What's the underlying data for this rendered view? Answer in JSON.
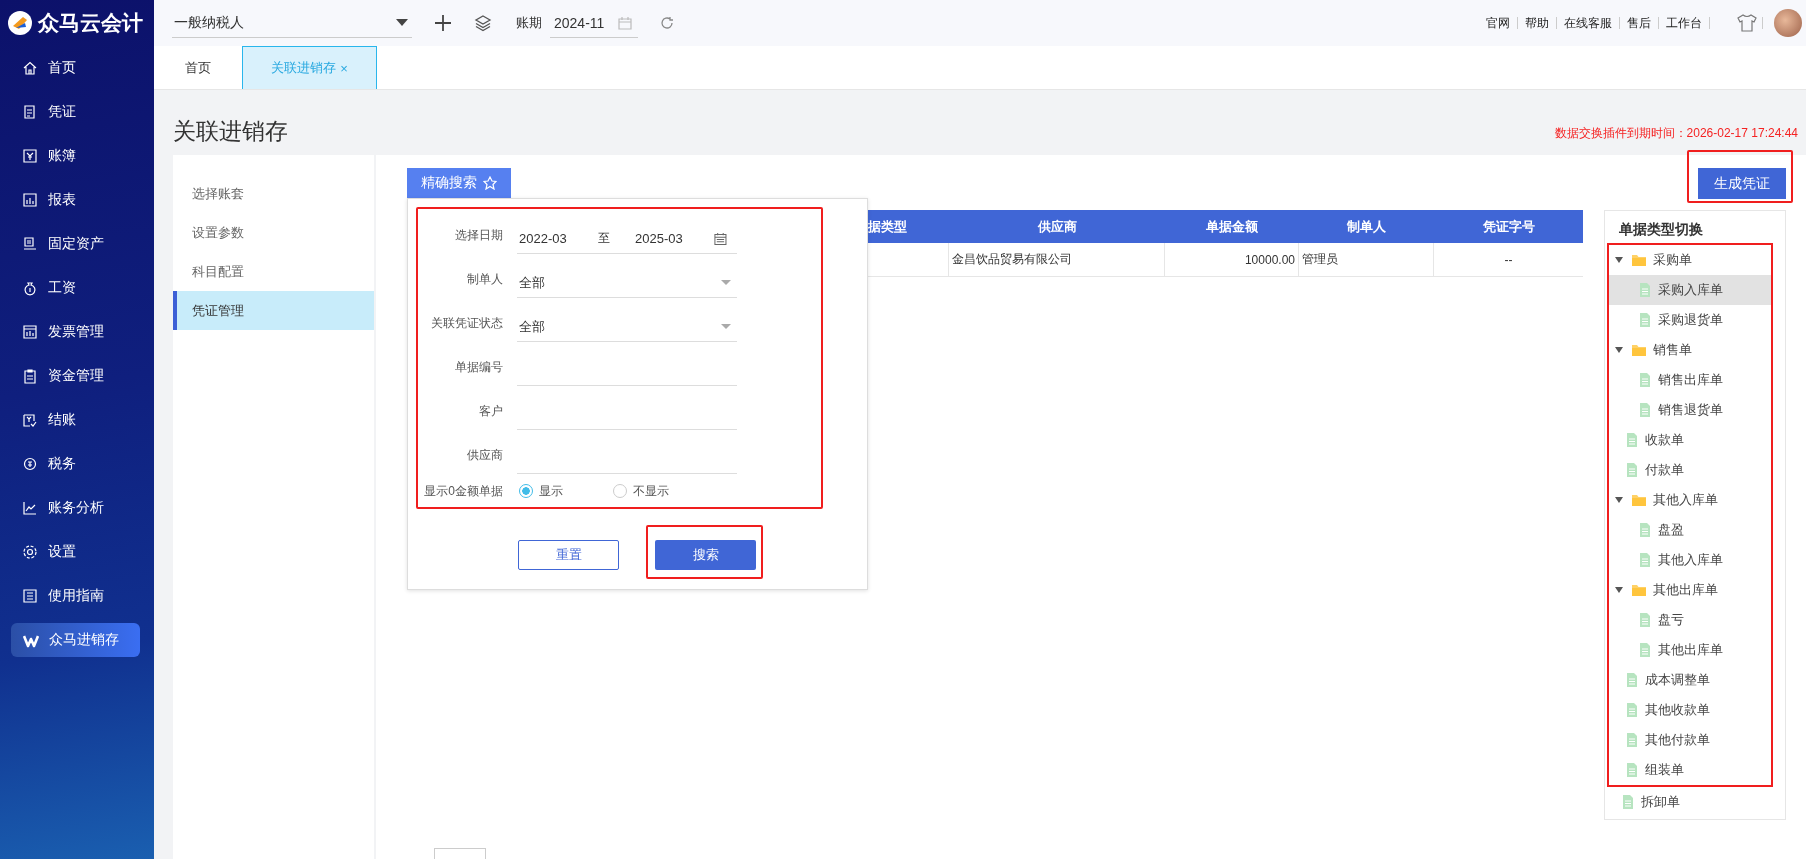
{
  "app": {
    "name": "众马云会计"
  },
  "topbar": {
    "taxpayer_select": "一般纳税人",
    "period_label": "账期",
    "period": "2024-11",
    "links": [
      "官网",
      "帮助",
      "在线客服",
      "售后",
      "工作台"
    ]
  },
  "sidebar": {
    "items": [
      {
        "label": "首页",
        "selected": false
      },
      {
        "label": "凭证",
        "selected": false
      },
      {
        "label": "账簿",
        "selected": false
      },
      {
        "label": "报表",
        "selected": false
      },
      {
        "label": "固定资产",
        "selected": false
      },
      {
        "label": "工资",
        "selected": false
      },
      {
        "label": "发票管理",
        "selected": false
      },
      {
        "label": "资金管理",
        "selected": false
      },
      {
        "label": "结账",
        "selected": false
      },
      {
        "label": "税务",
        "selected": false
      },
      {
        "label": "账务分析",
        "selected": false
      },
      {
        "label": "设置",
        "selected": false
      },
      {
        "label": "使用指南",
        "selected": false
      },
      {
        "label": "众马进销存",
        "selected": true
      }
    ]
  },
  "tabs": [
    {
      "label": "首页",
      "selected": false
    },
    {
      "label": "关联进销存",
      "selected": true,
      "close": "×"
    }
  ],
  "page": {
    "title": "关联进销存",
    "notice": "数据交换插件到期时间：2026-02-17 17:24:44"
  },
  "settings_nav": {
    "items": [
      {
        "label": "选择账套",
        "selected": false
      },
      {
        "label": "设置参数",
        "selected": false
      },
      {
        "label": "科目配置",
        "selected": false
      },
      {
        "label": "凭证管理",
        "selected": true
      }
    ]
  },
  "search_panel": {
    "tab_label": "精确搜索",
    "highlighted": true,
    "fields": [
      {
        "kind": "date_range",
        "label": "选择日期",
        "from": "2022-03",
        "separator": "至",
        "to": "2025-03"
      },
      {
        "kind": "select",
        "label": "制单人",
        "value": "全部"
      },
      {
        "kind": "select",
        "label": "关联凭证状态",
        "value": "全部"
      },
      {
        "kind": "text",
        "label": "单据编号"
      },
      {
        "kind": "text",
        "label": "客户"
      },
      {
        "kind": "text",
        "label": "供应商"
      },
      {
        "kind": "radio",
        "label": "显示0金额单据",
        "options": [
          {
            "label": "显示",
            "selected": true
          },
          {
            "label": "不显示",
            "selected": false
          }
        ]
      }
    ],
    "buttons": [
      {
        "kind": "secondary",
        "label": "重置",
        "highlighted": false
      },
      {
        "kind": "primary",
        "label": "搜索",
        "highlighted": true
      }
    ]
  },
  "generate_button": {
    "label": "生成凭证",
    "highlighted": true
  },
  "table": {
    "columns": [
      "据类型",
      "供应商",
      "单据金额",
      "制单人",
      "凭证字号"
    ],
    "rows": [
      {
        "supplier": "金昌饮品贸易有限公司",
        "amount": "10000.00",
        "creator": "管理员",
        "voucher_no": "--"
      }
    ]
  },
  "doc_type_tree": {
    "title": "单据类型切换",
    "items": [
      {
        "kind": "folder",
        "label": "采购单",
        "expanded": true,
        "selected": false,
        "highlighted": true,
        "children": [
          {
            "kind": "file",
            "label": "采购入库单",
            "selected": true
          },
          {
            "kind": "file",
            "label": "采购退货单",
            "selected": false
          }
        ]
      },
      {
        "kind": "folder",
        "label": "销售单",
        "expanded": true,
        "selected": false,
        "highlighted": true,
        "children": [
          {
            "kind": "file",
            "label": "销售出库单",
            "selected": false
          },
          {
            "kind": "file",
            "label": "销售退货单",
            "selected": false
          }
        ]
      },
      {
        "kind": "file",
        "label": "收款单",
        "selected": false,
        "highlighted": true
      },
      {
        "kind": "file",
        "label": "付款单",
        "selected": false,
        "highlighted": true
      },
      {
        "kind": "folder",
        "label": "其他入库单",
        "expanded": true,
        "selected": false,
        "highlighted": true,
        "children": [
          {
            "kind": "file",
            "label": "盘盈",
            "selected": false
          },
          {
            "kind": "file",
            "label": "其他入库单",
            "selected": false
          }
        ]
      },
      {
        "kind": "folder",
        "label": "其他出库单",
        "expanded": true,
        "selected": false,
        "highlighted": true,
        "children": [
          {
            "kind": "file",
            "label": "盘亏",
            "selected": false
          },
          {
            "kind": "file",
            "label": "其他出库单",
            "selected": false
          }
        ]
      },
      {
        "kind": "file",
        "label": "成本调整单",
        "selected": false,
        "highlighted": true
      },
      {
        "kind": "file",
        "label": "其他收款单",
        "selected": false,
        "highlighted": true
      },
      {
        "kind": "file",
        "label": "其他付款单",
        "selected": false,
        "highlighted": true
      },
      {
        "kind": "file",
        "label": "组装单",
        "selected": false,
        "highlighted": true
      },
      {
        "kind": "file",
        "label": "拆卸单",
        "selected": false,
        "highlighted": false
      }
    ]
  }
}
